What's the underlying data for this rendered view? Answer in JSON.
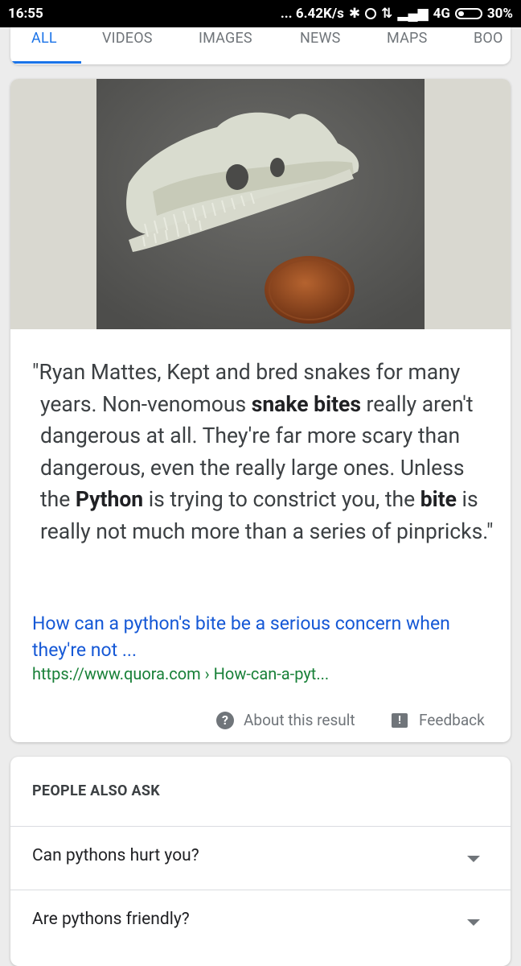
{
  "status_bar": {
    "time": "16:55",
    "speed": "... 6.42K/s",
    "network": "4G",
    "battery": "30%"
  },
  "tabs": [
    {
      "label": "ALL"
    },
    {
      "label": "VIDEOS"
    },
    {
      "label": "IMAGES"
    },
    {
      "label": "NEWS"
    },
    {
      "label": "MAPS"
    },
    {
      "label": "BOO"
    }
  ],
  "result": {
    "quote_open": "\"Ryan Mattes, Kept and bred snakes for many years. Non-venomous ",
    "bold1": "snake bites",
    "mid1": " really aren't dangerous at all. They're far more scary than dangerous, even the really large ones. Unless the ",
    "bold2": "Python",
    "mid2": " is trying to constrict you, the ",
    "bold3": "bite",
    "quote_close": " is really not much more than a series of pinpricks.\"",
    "link_title": "How can a python's bite be a serious concern when they're not ...",
    "link_url": "https://www.quora.com › How-can-a-pyt...",
    "about_label": "About this result",
    "feedback_label": "Feedback"
  },
  "people_also_ask": {
    "heading": "PEOPLE ALSO ASK",
    "questions": [
      "Can pythons hurt you?",
      "Are pythons friendly?"
    ]
  }
}
